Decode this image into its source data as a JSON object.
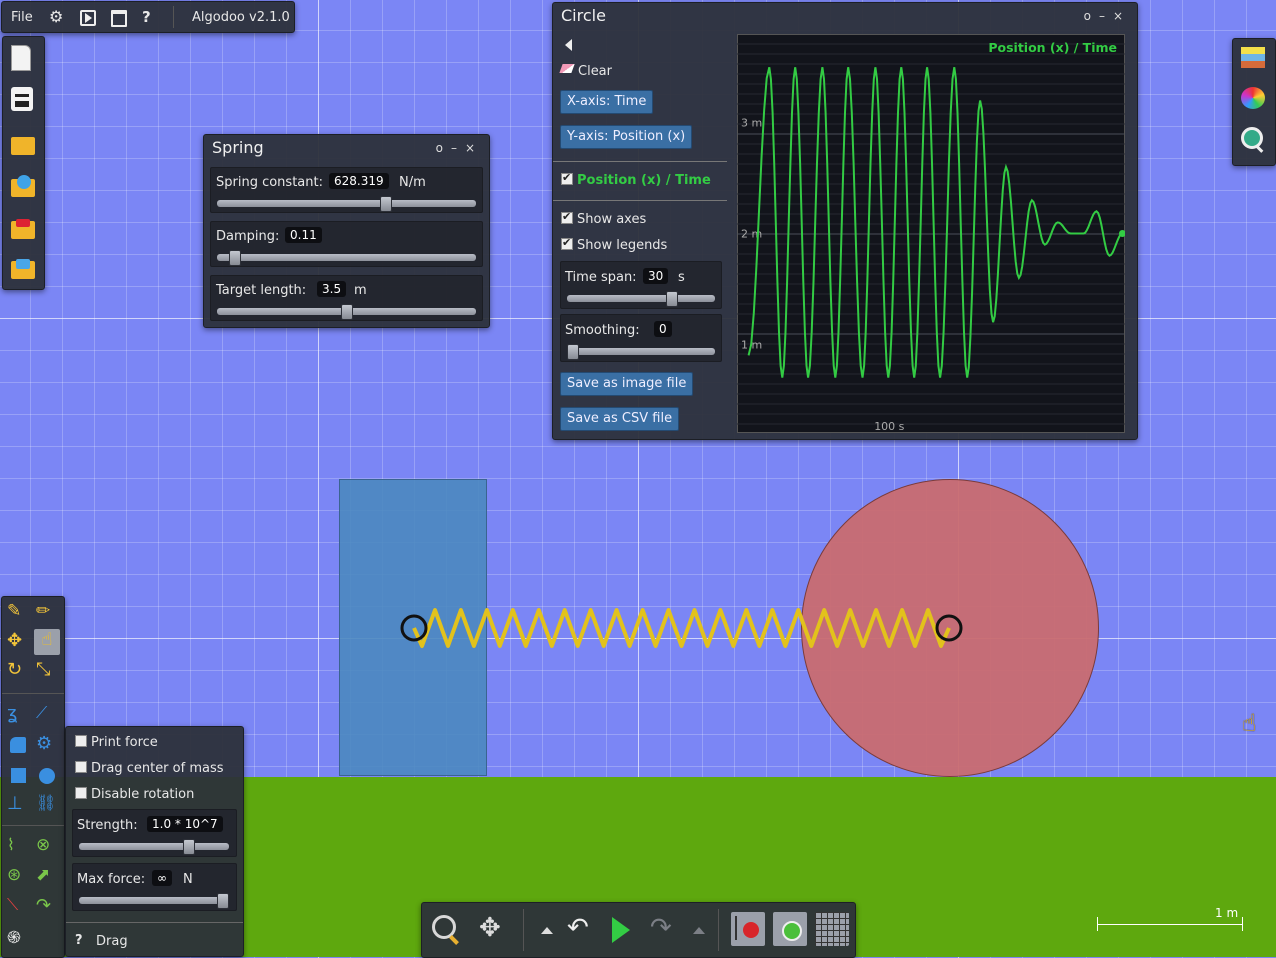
{
  "menubar": {
    "file_label": "File",
    "app_version": "Algodoo v2.1.0"
  },
  "spring_panel": {
    "title": "Spring",
    "spring_constant_label": "Spring constant:",
    "spring_constant_value": "628.319",
    "spring_constant_unit": "N/m",
    "spring_constant_level": 0.66,
    "damping_label": "Damping:",
    "damping_value": "0.11",
    "damping_level": 0.05,
    "target_length_label": "Target length:",
    "target_length_value": "3.5",
    "target_length_unit": "m",
    "target_length_level": 0.5
  },
  "graph_panel": {
    "title": "Circle",
    "clear_label": "Clear",
    "x_axis_button": "X-axis: Time",
    "y_axis_button": "Y-axis: Position (x)",
    "series_label": "Position (x) / Time",
    "show_axes_label": "Show axes",
    "show_legends_label": "Show legends",
    "time_span_label": "Time span:",
    "time_span_value": "30",
    "time_span_unit": "s",
    "time_span_level": 0.73,
    "smoothing_label": "Smoothing:",
    "smoothing_value": "0",
    "smoothing_level": 0.0,
    "save_image_label": "Save as image file",
    "save_csv_label": "Save as CSV file"
  },
  "chart_data": {
    "type": "line",
    "title": "Position (x) / Time",
    "xlabel": "",
    "ylabel": "",
    "x_tick_labels": [
      "100 s"
    ],
    "y_tick_labels": [
      "3 m",
      "2 m",
      "1 m"
    ],
    "xlim": [
      88,
      118
    ],
    "ylim": [
      0.2,
      3.8
    ],
    "grid": true,
    "legend": "top-right",
    "series": [
      {
        "name": "Position (x) / Time",
        "color": "#33cc44",
        "x": [
          88.9,
          90.5,
          91.5,
          92.5,
          93.5,
          94.6,
          95.6,
          96.6,
          97.7,
          98.7,
          99.7,
          100.7,
          101.7,
          102.7,
          103.7,
          104.8,
          105.8,
          106.8,
          107.8,
          108.8,
          109.8,
          110.8,
          111.8,
          112.8,
          113.8,
          114.8,
          115.8,
          116.8,
          117.8
        ],
        "y": [
          0.9,
          3.5,
          0.7,
          3.5,
          0.7,
          3.5,
          0.7,
          3.5,
          0.7,
          3.5,
          0.7,
          3.5,
          0.7,
          3.5,
          0.7,
          3.5,
          0.7,
          3.2,
          1.2,
          2.6,
          1.6,
          2.3,
          1.9,
          2.1,
          2.0,
          2.0,
          2.2,
          1.8,
          2.0
        ]
      }
    ]
  },
  "drag_panel": {
    "print_force_label": "Print force",
    "drag_com_label": "Drag center of mass",
    "disable_rotation_label": "Disable rotation",
    "strength_label": "Strength:",
    "strength_value": "1.0 * 10^7",
    "strength_level": 0.75,
    "max_force_label": "Max force:",
    "max_force_value": "∞",
    "max_force_unit": "N",
    "max_force_level": 1.0,
    "help_glyph": "?",
    "tool_name": "Drag"
  },
  "scale": {
    "label": "1 m"
  },
  "colors": {
    "sky": "#7b86f5",
    "ground": "#5ea80e",
    "box_fill": "#4b88c0",
    "circle_fill": "#c96c70",
    "spring": "#e2c21c",
    "graph_line": "#33cc44",
    "button": "#3a6fa4"
  }
}
